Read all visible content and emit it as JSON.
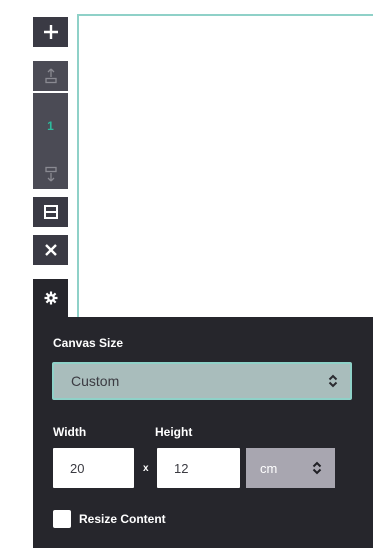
{
  "toolbar": {
    "buttons": [
      {
        "name": "add",
        "icon": "plus-icon"
      },
      {
        "name": "move-page-up",
        "icon": "move-up-icon"
      },
      {
        "name": "page-number",
        "label": "1"
      },
      {
        "name": "move-page-down",
        "icon": "move-down-icon"
      },
      {
        "name": "page-layout",
        "icon": "layout-icon"
      },
      {
        "name": "delete",
        "icon": "close-icon"
      },
      {
        "name": "settings",
        "icon": "gear-icon"
      }
    ],
    "page_number": "1"
  },
  "canvas_settings": {
    "title": "Canvas Size",
    "size_preset": "Custom",
    "width_label": "Width",
    "height_label": "Height",
    "width_value": "20",
    "height_value": "12",
    "times_symbol": "x",
    "unit": "cm",
    "resize_content_label": "Resize Content",
    "resize_content_checked": false
  },
  "colors": {
    "toolbar_bg": "#3a3a44",
    "panel_bg": "#26262c",
    "accent": "#2dbb9d",
    "select_bg": "#a9bdbc",
    "select_border": "#8fd1c8"
  }
}
